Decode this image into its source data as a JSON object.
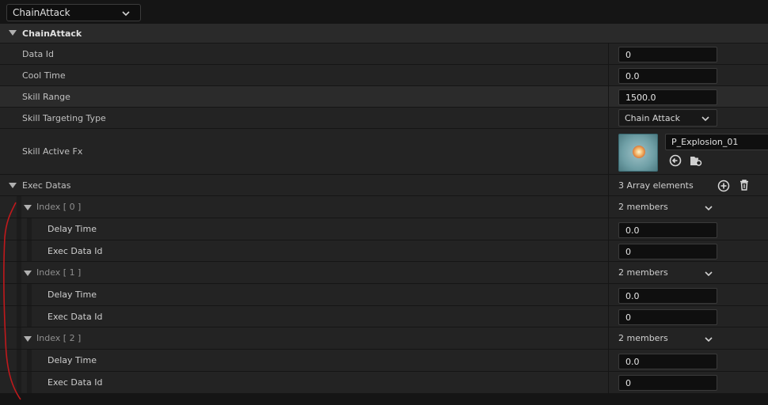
{
  "topbar": {
    "dropdown_value": "ChainAttack"
  },
  "category": {
    "title": "ChainAttack"
  },
  "properties": {
    "data_id": {
      "label": "Data Id",
      "value": "0"
    },
    "cool_time": {
      "label": "Cool Time",
      "value": "0.0"
    },
    "skill_range": {
      "label": "Skill Range",
      "value": "1500.0"
    },
    "skill_targeting_type": {
      "label": "Skill Targeting Type",
      "value": "Chain Attack"
    },
    "skill_active_fx": {
      "label": "Skill Active Fx",
      "asset": "P_Explosion_01"
    }
  },
  "exec_datas": {
    "label": "Exec Datas",
    "count_text": "3 Array elements",
    "items": [
      {
        "index_label": "Index [ 0 ]",
        "members": "2 members",
        "delay_label": "Delay Time",
        "delay_value": "0.0",
        "exec_label": "Exec Data Id",
        "exec_value": "0"
      },
      {
        "index_label": "Index [ 1 ]",
        "members": "2 members",
        "delay_label": "Delay Time",
        "delay_value": "0.0",
        "exec_label": "Exec Data Id",
        "exec_value": "0"
      },
      {
        "index_label": "Index [ 2 ]",
        "members": "2 members",
        "delay_label": "Delay Time",
        "delay_value": "0.0",
        "exec_label": "Exec Data Id",
        "exec_value": "0"
      }
    ]
  },
  "icons": {
    "dropdown": "chevron-down-icon",
    "collapse": "triangle-down-icon",
    "add": "add-circle-icon",
    "delete": "trash-icon",
    "use_selected": "arrow-left-circle-icon",
    "browse": "browse-folder-icon"
  },
  "colors": {
    "panel_bg": "#151515",
    "row_bg": "#232323",
    "row_alt_bg": "#2b2b2b",
    "header_bg": "#2a2a2a",
    "annotation_red": "#c0191c"
  }
}
